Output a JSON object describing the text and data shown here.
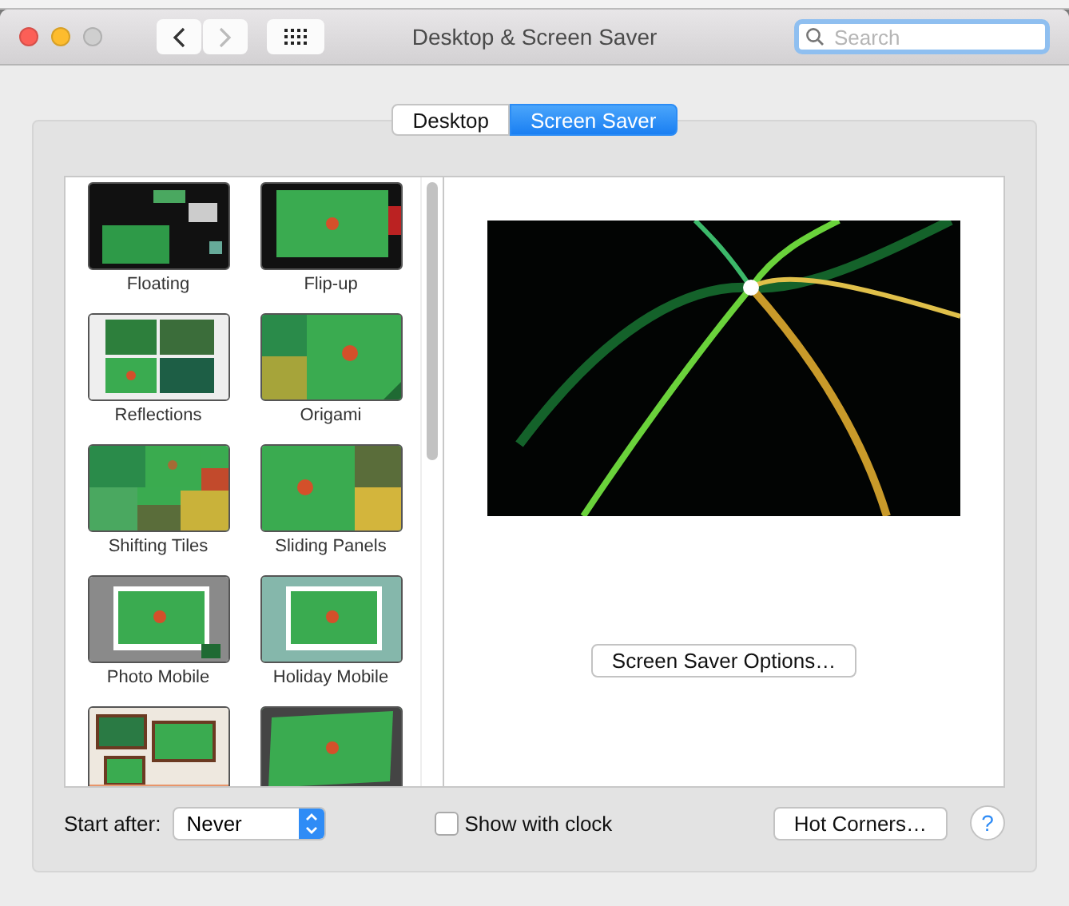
{
  "window": {
    "title": "Desktop & Screen Saver"
  },
  "search": {
    "placeholder": "Search"
  },
  "tabs": [
    {
      "label": "Desktop",
      "selected": false
    },
    {
      "label": "Screen Saver",
      "selected": true
    }
  ],
  "savers": [
    {
      "kind": "picture",
      "label": "Floating"
    },
    {
      "kind": "picture",
      "label": "Flip-up"
    },
    {
      "kind": "picture",
      "label": "Reflections"
    },
    {
      "kind": "picture",
      "label": "Origami"
    },
    {
      "kind": "picture",
      "label": "Shifting Tiles"
    },
    {
      "kind": "picture",
      "label": "Sliding Panels"
    },
    {
      "kind": "picture",
      "label": "Photo Mobile"
    },
    {
      "kind": "picture",
      "label": "Holiday Mobile"
    },
    {
      "kind": "picture"
    },
    {
      "kind": "picture"
    }
  ],
  "options_button": "Screen Saver Options…",
  "start_after": {
    "label": "Start after:",
    "value": "Never"
  },
  "show_with_clock": {
    "label": "Show with clock",
    "checked": false
  },
  "hot_corners_button": "Hot Corners…",
  "help_button": "?"
}
